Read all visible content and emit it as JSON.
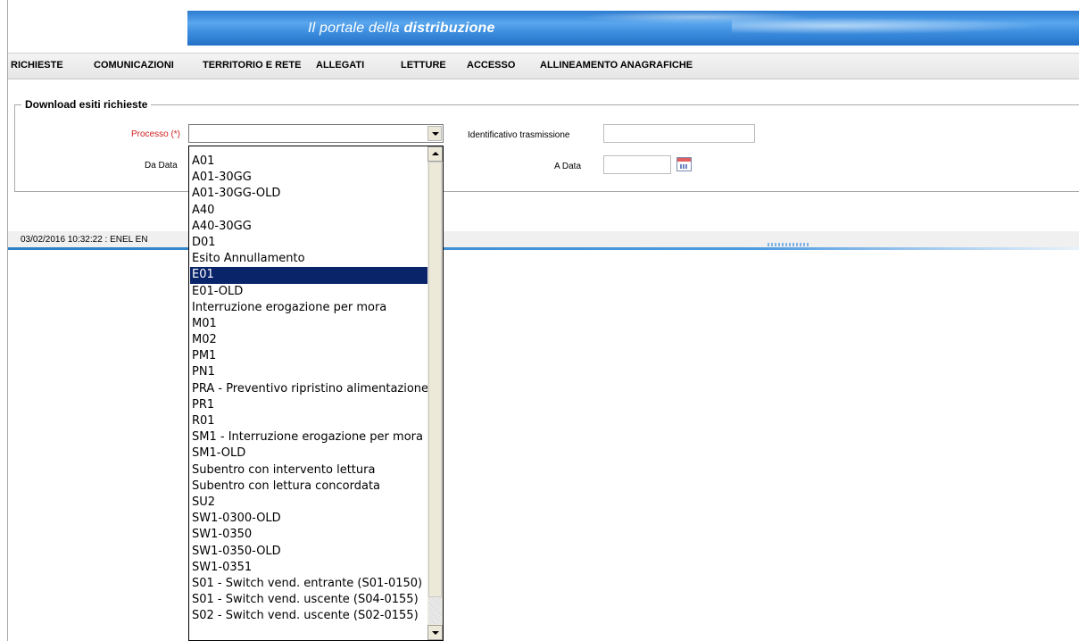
{
  "banner": {
    "title_prefix": "Il portale della ",
    "title_bold": "distribuzione"
  },
  "nav": {
    "items": [
      "RICHIESTE",
      "COMUNICAZIONI",
      "TERRITORIO E RETE",
      "ALLEGATI",
      "LETTURE",
      "ACCESSO",
      "ALLINEAMENTO ANAGRAFICHE"
    ]
  },
  "form": {
    "legend": "Download esiti richieste",
    "processo_label": "Processo (*)",
    "processo_value": "",
    "da_data_label": "Da Data",
    "id_trasmissione_label": "Identificativo trasmissione",
    "id_trasmissione_value": "",
    "a_data_label": "A Data",
    "a_data_value": ""
  },
  "status": {
    "text": "03/02/2016 10:32:22  :  ENEL EN"
  },
  "dropdown": {
    "selected": "E01",
    "options": [
      "A01",
      "A01-30GG",
      "A01-30GG-OLD",
      "A40",
      "A40-30GG",
      "D01",
      "Esito Annullamento",
      "E01",
      "E01-OLD",
      "Interruzione erogazione per mora",
      "M01",
      "M02",
      "PM1",
      "PN1",
      "PRA - Preventivo ripristino alimentazione",
      "PR1",
      "R01",
      "SM1 - Interruzione erogazione per mora",
      "SM1-OLD",
      "Subentro con intervento lettura",
      "Subentro con lettura concordata",
      "SU2",
      "SW1-0300-OLD",
      "SW1-0350",
      "SW1-0350-OLD",
      "SW1-0351",
      "S01 - Switch vend. entrante (S01-0150)",
      "S01 - Switch vend. uscente (S04-0155)",
      "S02 - Switch vend. uscente (S02-0155)"
    ]
  },
  "colors": {
    "required_label": "#d02020",
    "selection": "#0a246a",
    "banner": "#3e8fe0"
  }
}
